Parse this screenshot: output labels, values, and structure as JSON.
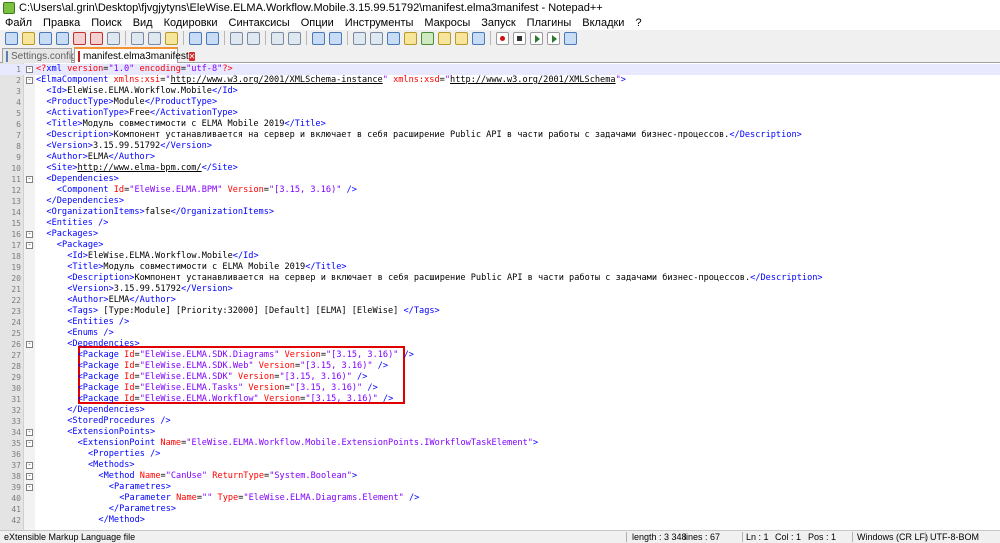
{
  "window": {
    "title": "C:\\Users\\al.grin\\Desktop\\fjvgjytyns\\EleWise.ELMA.Workflow.Mobile.3.15.99.51792\\manifest.elma3manifest - Notepad++"
  },
  "menu": [
    "Файл",
    "Правка",
    "Поиск",
    "Вид",
    "Кодировки",
    "Синтаксисы",
    "Опции",
    "Инструменты",
    "Макросы",
    "Запуск",
    "Плагины",
    "Вкладки",
    "?"
  ],
  "tabs": [
    {
      "label": "Settings.config",
      "active": false
    },
    {
      "label": "manifest.elma3manifest",
      "active": true
    }
  ],
  "tab_close_glyph": "✕",
  "editor": {
    "current_line": 1,
    "lines": [
      {
        "n": "1",
        "fold": "-",
        "indent": 1,
        "parts": [
          [
            "pi",
            "<?"
          ],
          [
            "t",
            "xml "
          ],
          [
            "a",
            "version"
          ],
          [
            "x",
            "="
          ],
          [
            "v",
            "\"1.0\" "
          ],
          [
            "a",
            "encoding"
          ],
          [
            "x",
            "="
          ],
          [
            "v",
            "\"utf-8\""
          ],
          [
            "pi",
            "?>"
          ]
        ]
      },
      {
        "n": "2",
        "fold": "-",
        "indent": 1,
        "parts": [
          [
            "t",
            "<ElmaComponent "
          ],
          [
            "a",
            "xmlns:xsi"
          ],
          [
            "x",
            "="
          ],
          [
            "v",
            "\""
          ],
          [
            "u",
            "http://www.w3.org/2001/XMLSchema-instance"
          ],
          [
            "v",
            "\" "
          ],
          [
            "a",
            "xmlns:xsd"
          ],
          [
            "x",
            "="
          ],
          [
            "v",
            "\""
          ],
          [
            "u",
            "http://www.w3.org/2001/XMLSchema"
          ],
          [
            "v",
            "\""
          ],
          [
            "t",
            ">"
          ]
        ]
      },
      {
        "n": "3",
        "indent": 3,
        "parts": [
          [
            "t",
            "<Id>"
          ],
          [
            "x",
            "EleWise.ELMA.Workflow.Mobile"
          ],
          [
            "t",
            "</Id>"
          ]
        ]
      },
      {
        "n": "4",
        "indent": 3,
        "parts": [
          [
            "t",
            "<ProductType>"
          ],
          [
            "x",
            "Module"
          ],
          [
            "t",
            "</ProductType>"
          ]
        ]
      },
      {
        "n": "5",
        "indent": 3,
        "parts": [
          [
            "t",
            "<ActivationType>"
          ],
          [
            "x",
            "Free"
          ],
          [
            "t",
            "</ActivationType>"
          ]
        ]
      },
      {
        "n": "6",
        "indent": 3,
        "parts": [
          [
            "t",
            "<Title>"
          ],
          [
            "x",
            "Модуль совместимости с ELMA Mobile 2019"
          ],
          [
            "t",
            "</Title>"
          ]
        ]
      },
      {
        "n": "7",
        "indent": 3,
        "parts": [
          [
            "t",
            "<Description>"
          ],
          [
            "x",
            "Компонент устанавливается на сервер и включает в себя расширение Public API в части работы с задачами бизнес-процессов."
          ],
          [
            "t",
            "</Description>"
          ]
        ]
      },
      {
        "n": "8",
        "indent": 3,
        "parts": [
          [
            "t",
            "<Version>"
          ],
          [
            "x",
            "3.15.99.51792"
          ],
          [
            "t",
            "</Version>"
          ]
        ]
      },
      {
        "n": "9",
        "indent": 3,
        "parts": [
          [
            "t",
            "<Author>"
          ],
          [
            "x",
            "ELMA"
          ],
          [
            "t",
            "</Author>"
          ]
        ]
      },
      {
        "n": "10",
        "indent": 3,
        "parts": [
          [
            "t",
            "<Site>"
          ],
          [
            "u",
            "http://www.elma-bpm.com/"
          ],
          [
            "t",
            "</Site>"
          ]
        ]
      },
      {
        "n": "11",
        "fold": "-",
        "indent": 3,
        "parts": [
          [
            "t",
            "<Dependencies>"
          ]
        ]
      },
      {
        "n": "12",
        "indent": 5,
        "parts": [
          [
            "t",
            "<Component "
          ],
          [
            "a",
            "Id"
          ],
          [
            "x",
            "="
          ],
          [
            "v",
            "\"EleWise.ELMA.BPM\" "
          ],
          [
            "a",
            "Version"
          ],
          [
            "x",
            "="
          ],
          [
            "v",
            "\"[3.15, 3.16)\" "
          ],
          [
            "t",
            "/>"
          ]
        ]
      },
      {
        "n": "13",
        "indent": 3,
        "parts": [
          [
            "t",
            "</Dependencies>"
          ]
        ]
      },
      {
        "n": "14",
        "indent": 3,
        "parts": [
          [
            "t",
            "<OrganizationItems>"
          ],
          [
            "x",
            "false"
          ],
          [
            "t",
            "</OrganizationItems>"
          ]
        ]
      },
      {
        "n": "15",
        "indent": 3,
        "parts": [
          [
            "t",
            "<Entities />"
          ]
        ]
      },
      {
        "n": "16",
        "fold": "-",
        "indent": 3,
        "parts": [
          [
            "t",
            "<Packages>"
          ]
        ]
      },
      {
        "n": "17",
        "fold": "-",
        "indent": 5,
        "parts": [
          [
            "t",
            "<Package>"
          ]
        ]
      },
      {
        "n": "18",
        "indent": 7,
        "parts": [
          [
            "t",
            "<Id>"
          ],
          [
            "x",
            "EleWise.ELMA.Workflow.Mobile"
          ],
          [
            "t",
            "</Id>"
          ]
        ]
      },
      {
        "n": "19",
        "indent": 7,
        "parts": [
          [
            "t",
            "<Title>"
          ],
          [
            "x",
            "Модуль совместимости с ELMA Mobile 2019"
          ],
          [
            "t",
            "</Title>"
          ]
        ]
      },
      {
        "n": "20",
        "indent": 7,
        "parts": [
          [
            "t",
            "<Description>"
          ],
          [
            "x",
            "Компонент устанавливается на сервер и включает в себя расширение Public API в части работы с задачами бизнес-процессов."
          ],
          [
            "t",
            "</Description>"
          ]
        ]
      },
      {
        "n": "21",
        "indent": 7,
        "parts": [
          [
            "t",
            "<Version>"
          ],
          [
            "x",
            "3.15.99.51792"
          ],
          [
            "t",
            "</Version>"
          ]
        ]
      },
      {
        "n": "22",
        "indent": 7,
        "parts": [
          [
            "t",
            "<Author>"
          ],
          [
            "x",
            "ELMA"
          ],
          [
            "t",
            "</Author>"
          ]
        ]
      },
      {
        "n": "23",
        "indent": 7,
        "parts": [
          [
            "t",
            "<Tags> "
          ],
          [
            "x",
            "[Type:Module] [Priority:32000] [Default] [ELMA] [EleWise] "
          ],
          [
            "t",
            "</Tags>"
          ]
        ]
      },
      {
        "n": "24",
        "indent": 7,
        "parts": [
          [
            "t",
            "<Entities />"
          ]
        ]
      },
      {
        "n": "25",
        "indent": 7,
        "parts": [
          [
            "t",
            "<Enums />"
          ]
        ]
      },
      {
        "n": "26",
        "fold": "-",
        "indent": 7,
        "parts": [
          [
            "t",
            "<Dependencies>"
          ]
        ]
      },
      {
        "n": "27",
        "indent": 9,
        "parts": [
          [
            "t",
            "<Package "
          ],
          [
            "a",
            "Id"
          ],
          [
            "x",
            "="
          ],
          [
            "v",
            "\"EleWise.ELMA.SDK.Diagrams\" "
          ],
          [
            "a",
            "Version"
          ],
          [
            "x",
            "="
          ],
          [
            "v",
            "\"[3.15, 3.16)\" "
          ],
          [
            "t",
            "/>"
          ]
        ]
      },
      {
        "n": "28",
        "indent": 9,
        "parts": [
          [
            "t",
            "<Package "
          ],
          [
            "a",
            "Id"
          ],
          [
            "x",
            "="
          ],
          [
            "v",
            "\"EleWise.ELMA.SDK.Web\" "
          ],
          [
            "a",
            "Version"
          ],
          [
            "x",
            "="
          ],
          [
            "v",
            "\"[3.15, 3.16)\" "
          ],
          [
            "t",
            "/>"
          ]
        ]
      },
      {
        "n": "29",
        "indent": 9,
        "parts": [
          [
            "t",
            "<Package "
          ],
          [
            "a",
            "Id"
          ],
          [
            "x",
            "="
          ],
          [
            "v",
            "\"EleWise.ELMA.SDK\" "
          ],
          [
            "a",
            "Version"
          ],
          [
            "x",
            "="
          ],
          [
            "v",
            "\"[3.15, 3.16)\" "
          ],
          [
            "t",
            "/>"
          ]
        ]
      },
      {
        "n": "30",
        "indent": 9,
        "parts": [
          [
            "t",
            "<Package "
          ],
          [
            "a",
            "Id"
          ],
          [
            "x",
            "="
          ],
          [
            "v",
            "\"EleWise.ELMA.Tasks\" "
          ],
          [
            "a",
            "Version"
          ],
          [
            "x",
            "="
          ],
          [
            "v",
            "\"[3.15, 3.16)\" "
          ],
          [
            "t",
            "/>"
          ]
        ]
      },
      {
        "n": "31",
        "indent": 9,
        "parts": [
          [
            "t",
            "<Package "
          ],
          [
            "a",
            "Id"
          ],
          [
            "x",
            "="
          ],
          [
            "v",
            "\"EleWise.ELMA.Workflow\" "
          ],
          [
            "a",
            "Version"
          ],
          [
            "x",
            "="
          ],
          [
            "v",
            "\"[3.15, 3.16)\" "
          ],
          [
            "t",
            "/>"
          ]
        ]
      },
      {
        "n": "32",
        "indent": 7,
        "parts": [
          [
            "t",
            "</Dependencies>"
          ]
        ]
      },
      {
        "n": "33",
        "indent": 7,
        "parts": [
          [
            "t",
            "<StoredProcedures />"
          ]
        ]
      },
      {
        "n": "34",
        "fold": "-",
        "indent": 7,
        "parts": [
          [
            "t",
            "<ExtensionPoints>"
          ]
        ]
      },
      {
        "n": "35",
        "fold": "-",
        "indent": 9,
        "parts": [
          [
            "t",
            "<ExtensionPoint "
          ],
          [
            "a",
            "Name"
          ],
          [
            "x",
            "="
          ],
          [
            "v",
            "\"EleWise.ELMA.Workflow.Mobile.ExtensionPoints.IWorkflowTaskElement\""
          ],
          [
            "t",
            ">"
          ]
        ]
      },
      {
        "n": "36",
        "indent": 11,
        "parts": [
          [
            "t",
            "<Properties />"
          ]
        ]
      },
      {
        "n": "37",
        "fold": "-",
        "indent": 11,
        "parts": [
          [
            "t",
            "<Methods>"
          ]
        ]
      },
      {
        "n": "38",
        "fold": "-",
        "indent": 13,
        "parts": [
          [
            "t",
            "<Method "
          ],
          [
            "a",
            "Name"
          ],
          [
            "x",
            "="
          ],
          [
            "v",
            "\"CanUse\" "
          ],
          [
            "a",
            "ReturnType"
          ],
          [
            "x",
            "="
          ],
          [
            "v",
            "\"System.Boolean\""
          ],
          [
            "t",
            ">"
          ]
        ]
      },
      {
        "n": "39",
        "fold": "-",
        "indent": 15,
        "parts": [
          [
            "t",
            "<Parametres>"
          ]
        ]
      },
      {
        "n": "40",
        "indent": 17,
        "parts": [
          [
            "t",
            "<Parameter "
          ],
          [
            "a",
            "Name"
          ],
          [
            "x",
            "="
          ],
          [
            "v",
            "\"\" "
          ],
          [
            "a",
            "Type"
          ],
          [
            "x",
            "="
          ],
          [
            "v",
            "\"EleWise.ELMA.Diagrams.Element\" "
          ],
          [
            "t",
            "/>"
          ]
        ]
      },
      {
        "n": "41",
        "indent": 15,
        "parts": [
          [
            "t",
            "</Parametres>"
          ]
        ]
      },
      {
        "n": "42",
        "indent": 13,
        "parts": [
          [
            "t",
            "</Method>"
          ]
        ]
      }
    ]
  },
  "status": {
    "file_type": "eXtensible Markup Language file",
    "length": "length : 3 348",
    "lines": "lines : 67",
    "ln": "Ln : 1",
    "col": "Col : 1",
    "pos": "Pos : 1",
    "eol": "Windows (CR LF)",
    "encoding": "UTF-8-BOM"
  }
}
